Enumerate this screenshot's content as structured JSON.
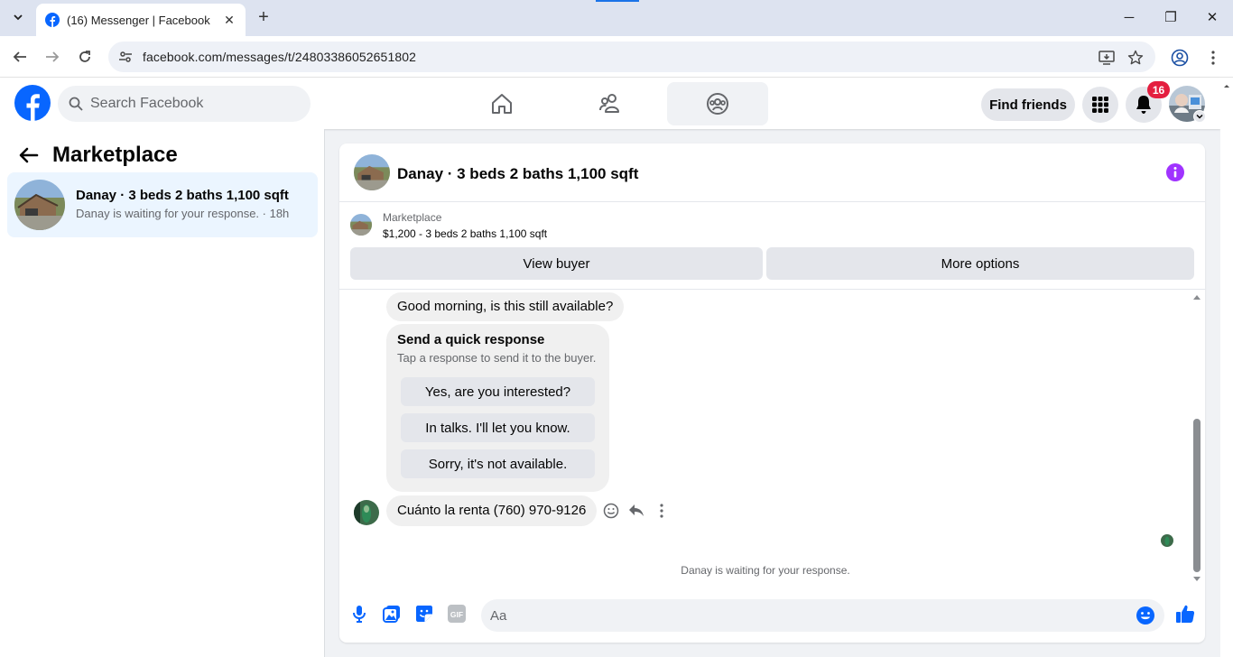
{
  "browser": {
    "tab_title": "(16) Messenger | Facebook",
    "tab_close": "✕",
    "new_tab": "+",
    "url": "facebook.com/messages/t/24803386052651802",
    "win_minimize": "─",
    "win_restore": "❐",
    "win_close": "✕"
  },
  "header": {
    "search_placeholder": "Search Facebook",
    "find_friends": "Find friends",
    "notification_count": "16"
  },
  "sidebar": {
    "title": "Marketplace",
    "conversation": {
      "title": "Danay · 3 beds 2 baths 1,100 sqft",
      "subtitle": "Danay is waiting for your response. · 18h"
    }
  },
  "chat": {
    "title": "Danay · 3 beds 2 baths 1,100 sqft",
    "listing": {
      "label": "Marketplace",
      "description": "$1,200 - 3 beds 2 baths 1,100 sqft",
      "view_buyer": "View buyer",
      "more_options": "More options"
    },
    "messages": {
      "first": "Good morning, is this still available?",
      "quick_response": {
        "title": "Send a quick response",
        "subtitle": "Tap a response to send it to the buyer.",
        "options": [
          "Yes, are you interested?",
          "In talks. I'll let you know.",
          "Sorry, it's not available."
        ]
      },
      "second": "Cuánto la renta (760) 970-9126"
    },
    "status": "Danay is waiting for your response.",
    "composer": {
      "placeholder": "Aa"
    }
  },
  "colors": {
    "facebook_blue": "#0866ff",
    "info_purple": "#a033ff",
    "badge_red": "#e41e3f",
    "selected_conv_bg": "#ebf5ff"
  }
}
